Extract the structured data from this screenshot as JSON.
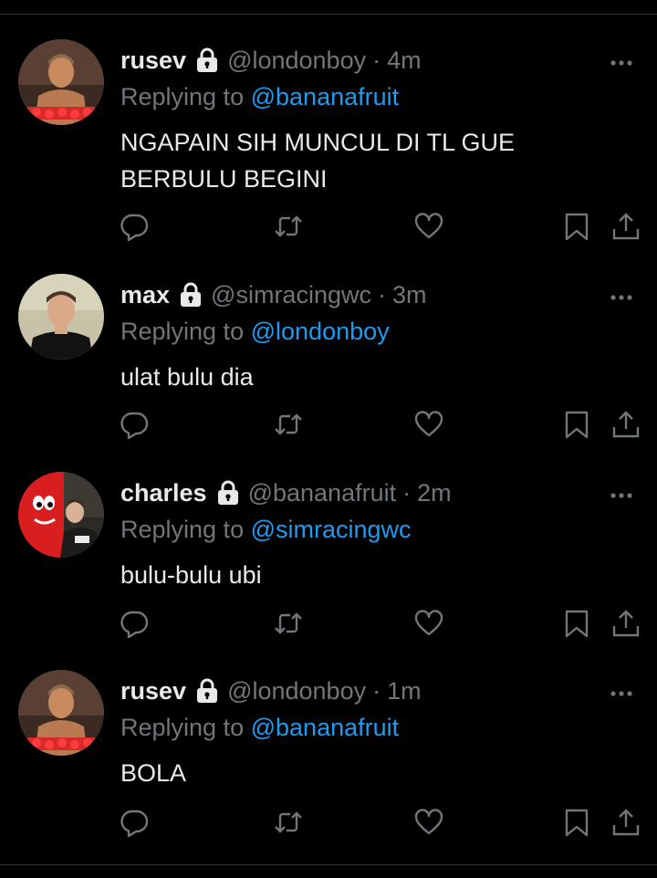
{
  "colors": {
    "background": "#000000",
    "text": "#e7e9ea",
    "muted": "#71767b",
    "link": "#1d9bf0",
    "divider": "#2f3336"
  },
  "tweets": [
    {
      "display_name": "rusev",
      "handle": "@londonboy",
      "separator": "·",
      "time": "4m",
      "replying_label": "Replying to",
      "replying_to": "@bananafruit",
      "text_lines": [
        "NGAPAIN SIH MUNCUL DI TL GUE",
        "BERBULU BEGINI"
      ],
      "protected_icon": "lock-icon",
      "avatar": "shirtless-man-avatar"
    },
    {
      "display_name": "max",
      "handle": "@simracingwc",
      "separator": "·",
      "time": "3m",
      "replying_label": "Replying to",
      "replying_to": "@londonboy",
      "text_lines": [
        "ulat bulu dia"
      ],
      "protected_icon": "lock-icon",
      "avatar": "man-in-black-shirt-avatar"
    },
    {
      "display_name": "charles",
      "handle": "@bananafruit",
      "separator": "·",
      "time": "2m",
      "replying_label": "Replying to",
      "replying_to": "@simracingwc",
      "text_lines": [
        "bulu-bulu ubi"
      ],
      "protected_icon": "lock-icon",
      "avatar": "red-character-and-man-avatar"
    },
    {
      "display_name": "rusev",
      "handle": "@londonboy",
      "separator": "·",
      "time": "1m",
      "replying_label": "Replying to",
      "replying_to": "@bananafruit",
      "text_lines": [
        "BOLA"
      ],
      "protected_icon": "lock-icon",
      "avatar": "shirtless-man-avatar"
    }
  ],
  "actions": [
    "reply-icon",
    "retweet-icon",
    "like-icon",
    "bookmark-icon",
    "share-icon"
  ]
}
